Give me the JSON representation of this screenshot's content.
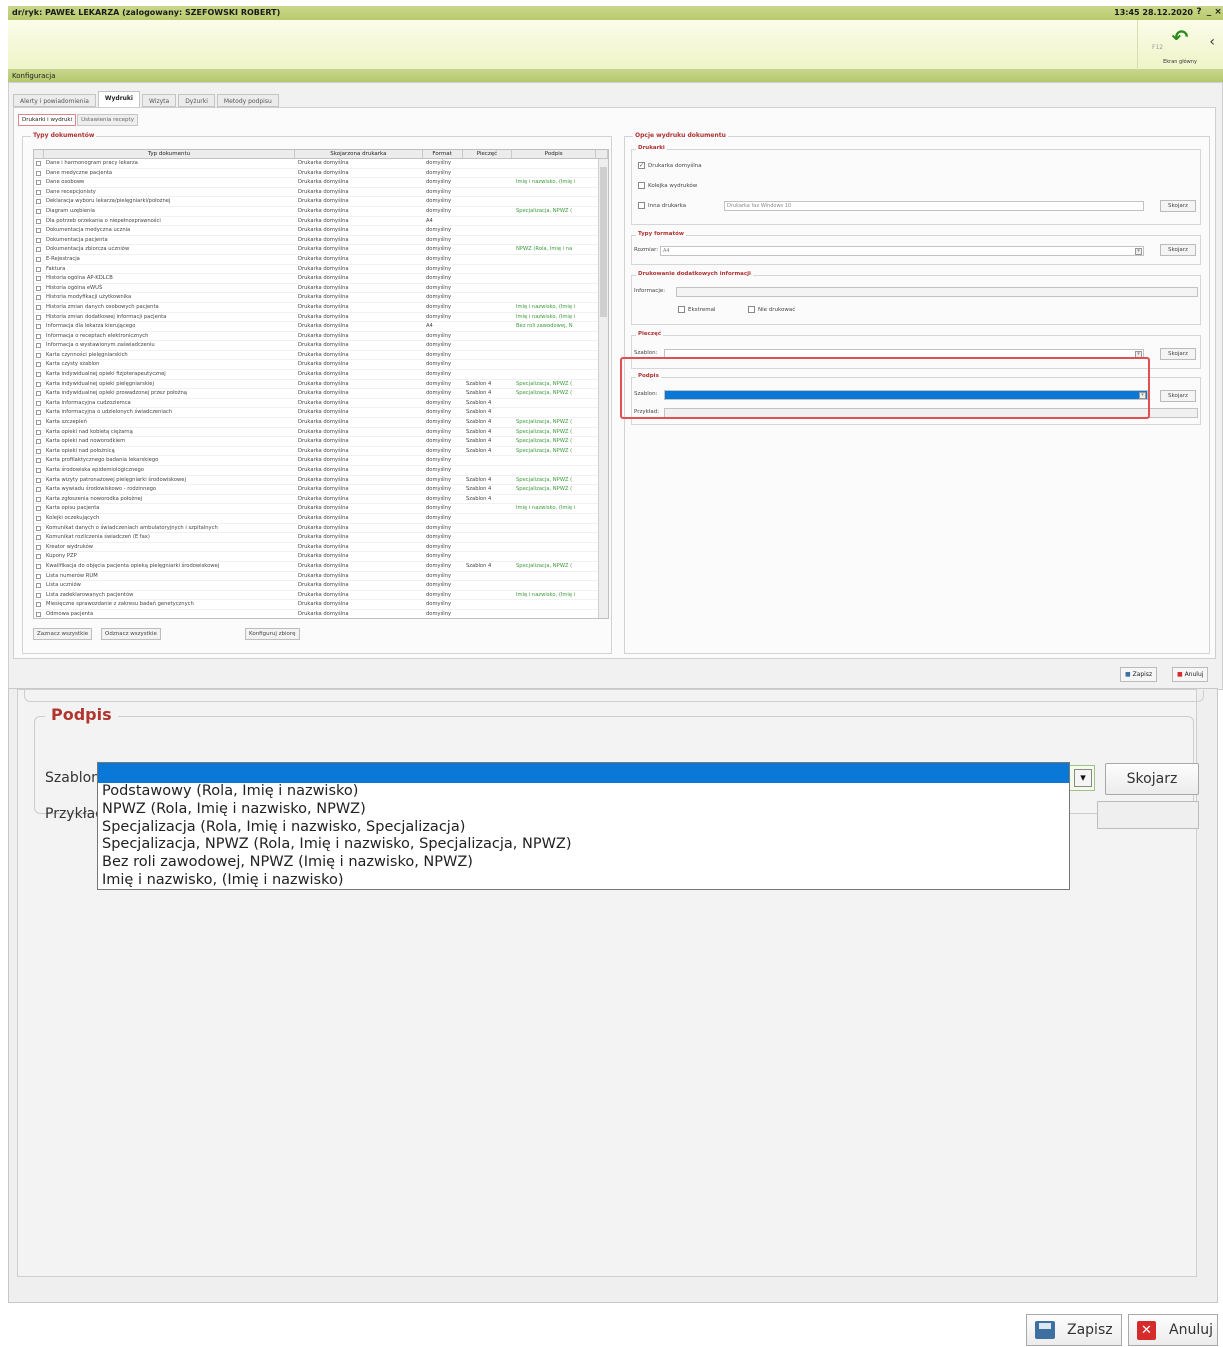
{
  "titlebar": {
    "title": "dr/ryk: PAWEŁ LEKARZA (zalogowany: SZEFOWSKI ROBERT)",
    "clock": "13:45 28.12.2020",
    "help": "?",
    "min": "_",
    "close": "×"
  },
  "toolbar": {
    "home_label": "Ekran główny",
    "home_icon": "undo-arrow-icon",
    "chevron": "‹",
    "small_text": "F12"
  },
  "section_title": "Konfiguracja",
  "tabs": [
    "Alerty i powiadomienia",
    "Wydruki",
    "Wizyta",
    "Dyżurki",
    "Metody podpisu"
  ],
  "subtabs": [
    "Drukarki i wydruki",
    "Ustawienia recepty"
  ],
  "doc_types": {
    "title": "Typy dokumentów",
    "headers": [
      "Typ dokumentu",
      "Skojarzona drukarka",
      "Format",
      "Pieczęć",
      "Podpis"
    ],
    "rows": [
      [
        "Dane i harmonogram pracy lekarza",
        "Drukarka domyślna",
        "domyślny",
        "",
        ""
      ],
      [
        "Dane medyczne pacjenta",
        "Drukarka domyślna",
        "domyślny",
        "",
        ""
      ],
      [
        "Dane osobowe",
        "Drukarka domyślna",
        "domyślny",
        "",
        "Imię i nazwisko, (Imię i"
      ],
      [
        "Dane recepcjonisty",
        "Drukarka domyślna",
        "domyślny",
        "",
        ""
      ],
      [
        "Deklaracja wyboru lekarza/pielęgniarki/położnej",
        "Drukarka domyślna",
        "domyślny",
        "",
        ""
      ],
      [
        "Diagram uzębienia",
        "Drukarka domyślna",
        "domyślny",
        "",
        "Specjalizacja, NPWZ ("
      ],
      [
        "Dla potrzeb orzekania o niepełnosprawności",
        "Drukarka domyślna",
        "A4",
        "",
        ""
      ],
      [
        "Dokumentacja medyczna ucznia",
        "Drukarka domyślna",
        "domyślny",
        "",
        ""
      ],
      [
        "Dokumentacja pacjenta",
        "Drukarka domyślna",
        "domyślny",
        "",
        ""
      ],
      [
        "Dokumentacja zbiorcza uczniów",
        "Drukarka domyślna",
        "domyślny",
        "",
        "NPWZ (Rola, Imię i na"
      ],
      [
        "E-Rejestracja",
        "Drukarka domyślna",
        "domyślny",
        "",
        ""
      ],
      [
        "Faktura",
        "Drukarka domyślna",
        "domyślny",
        "",
        ""
      ],
      [
        "Historia ogólna AP-KDLCB",
        "Drukarka domyślna",
        "domyślny",
        "",
        ""
      ],
      [
        "Historia ogólna eWUŚ",
        "Drukarka domyślna",
        "domyślny",
        "",
        ""
      ],
      [
        "Historia modyfikacji użytkownika",
        "Drukarka domyślna",
        "domyślny",
        "",
        ""
      ],
      [
        "Historia zmian danych osobowych pacjenta",
        "Drukarka domyślna",
        "domyślny",
        "",
        "Imię i nazwisko, (Imię i"
      ],
      [
        "Historia zmian dodatkowej informacji pacjenta",
        "Drukarka domyślna",
        "domyślny",
        "",
        "Imię i nazwisko, (Imię i"
      ],
      [
        "Informacja dla lekarza kierującego",
        "Drukarka domyślna",
        "A4",
        "",
        "Bez roli zawodowej, N"
      ],
      [
        "Informacja o receptach elektronicznych",
        "Drukarka domyślna",
        "domyślny",
        "",
        ""
      ],
      [
        "Informacja o wystawionym zaświadczeniu",
        "Drukarka domyślna",
        "domyślny",
        "",
        ""
      ],
      [
        "Karta czynności pielęgniarskich",
        "Drukarka domyślna",
        "domyślny",
        "",
        ""
      ],
      [
        "Karta czysty szablon",
        "Drukarka domyślna",
        "domyślny",
        "",
        ""
      ],
      [
        "Karta indywidualnej opieki fizjoterapeutycznej",
        "Drukarka domyślna",
        "domyślny",
        "",
        ""
      ],
      [
        "Karta indywidualnej opieki pielęgniarskiej",
        "Drukarka domyślna",
        "domyślny",
        "Szablon 4",
        "Specjalizacja, NPWZ ("
      ],
      [
        "Karta indywidualnej opieki prowadzonej przez położną",
        "Drukarka domyślna",
        "domyślny",
        "Szablon 4",
        "Specjalizacja, NPWZ ("
      ],
      [
        "Karta informacyjna cudzoziemca",
        "Drukarka domyślna",
        "domyślny",
        "Szablon 4",
        ""
      ],
      [
        "Karta informacyjna o udzielonych świadczeniach",
        "Drukarka domyślna",
        "domyślny",
        "Szablon 4",
        ""
      ],
      [
        "Karta szczepień",
        "Drukarka domyślna",
        "domyślny",
        "Szablon 4",
        "Specjalizacja, NPWZ ("
      ],
      [
        "Karta opieki nad kobietą ciężarną",
        "Drukarka domyślna",
        "domyślny",
        "Szablon 4",
        "Specjalizacja, NPWZ ("
      ],
      [
        "Karta opieki nad noworodkiem",
        "Drukarka domyślna",
        "domyślny",
        "Szablon 4",
        "Specjalizacja, NPWZ ("
      ],
      [
        "Karta opieki nad położnicą",
        "Drukarka domyślna",
        "domyślny",
        "Szablon 4",
        "Specjalizacja, NPWZ ("
      ],
      [
        "Karta profilaktycznego badania lekarskiego",
        "Drukarka domyślna",
        "domyślny",
        "",
        ""
      ],
      [
        "Karta środowiska epidemiologicznego",
        "Drukarka domyślna",
        "domyślny",
        "",
        ""
      ],
      [
        "Karta wizyty patronażowej pielęgniarki środowiskowej",
        "Drukarka domyślna",
        "domyślny",
        "Szablon 4",
        "Specjalizacja, NPWZ ("
      ],
      [
        "Karta wywiadu środowiskowo - rodzinnego",
        "Drukarka domyślna",
        "domyślny",
        "Szablon 4",
        "Specjalizacja, NPWZ ("
      ],
      [
        "Karta zgłoszenia noworodka położnej",
        "Drukarka domyślna",
        "domyślny",
        "Szablon 4",
        ""
      ],
      [
        "Karta opisu pacjenta",
        "Drukarka domyślna",
        "domyślny",
        "",
        "Imię i nazwisko, (Imię i"
      ],
      [
        "Kolejki oczekujących",
        "Drukarka domyślna",
        "domyślny",
        "",
        ""
      ],
      [
        "Komunikat danych o świadczeniach ambulatoryjnych i szpitalnych",
        "Drukarka domyślna",
        "domyślny",
        "",
        ""
      ],
      [
        "Komunikat rozliczenia świadczeń (E fax)",
        "Drukarka domyślna",
        "domyślny",
        "",
        ""
      ],
      [
        "Kreator wydruków",
        "Drukarka domyślna",
        "domyślny",
        "",
        ""
      ],
      [
        "Kupony PZP",
        "Drukarka domyślna",
        "domyślny",
        "",
        ""
      ],
      [
        "Kwalifikacja do objęcia pacjenta opieką pielęgniarki środowiskowej",
        "Drukarka domyślna",
        "domyślny",
        "Szablon 4",
        "Specjalizacja, NPWZ ("
      ],
      [
        "Lista numerów RUM",
        "Drukarka domyślna",
        "domyślny",
        "",
        ""
      ],
      [
        "Lista uczniów",
        "Drukarka domyślna",
        "domyślny",
        "",
        ""
      ],
      [
        "Lista zadeklarowanych pacjentów",
        "Drukarka domyślna",
        "domyślny",
        "",
        "Imię i nazwisko, (Imię i"
      ],
      [
        "Miesięczne sprawozdanie z zakresu badań genetycznych",
        "Drukarka domyślna",
        "domyślny",
        "",
        ""
      ],
      [
        "Odmowa pacjenta",
        "Drukarka domyślna",
        "domyślny",
        "",
        ""
      ]
    ],
    "select_all": "Zaznacz wszystkie",
    "deselect_all": "Odznacz wszystkie",
    "configure": "Konfiguruj zbiorę"
  },
  "print_opts": {
    "title": "Opcje wydruku dokumentu",
    "printers_title": "Drukarki",
    "default_printer": "Drukarka domyślna",
    "print_queue": "Kolejka wydruków",
    "other_printer": "Inna drukarka",
    "other_printer_value": "Drukarka fax Windows 10",
    "associate": "Skojarz",
    "formats_title": "Typy formatów",
    "format_label": "Rozmiar:",
    "format_value": "A4",
    "extra_title": "Drukowanie dodatkowych informacji",
    "extra_label": "Informacje:",
    "extra_cb1": "Ekstremal",
    "extra_cb2": "Nie drukować",
    "stamp_title": "Pieczęć",
    "stamp_label": "Szablon:",
    "sign_title": "Podpis",
    "sign_label": "Szablon:",
    "sign_example": "Przykład:"
  },
  "mini_footer": {
    "save": "Zapisz",
    "cancel": "Anuluj"
  },
  "zoom": {
    "title": "Podpis",
    "template_label": "Szablon:",
    "template_value": "",
    "associate": "Skojarz",
    "example_label": "Przykład:",
    "options": [
      "Podstawowy (Rola, Imię i nazwisko)",
      "NPWZ (Rola, Imię i nazwisko, NPWZ)",
      "Specjalizacja (Rola, Imię i nazwisko, Specjalizacja)",
      "Specjalizacja, NPWZ  (Rola, Imię i nazwisko, Specjalizacja, NPWZ)",
      "Bez roli zawodowej, NPWZ (Imię i nazwisko, NPWZ)",
      "Imię i nazwisko, (Imię i nazwisko)"
    ]
  },
  "footer": {
    "save": "Zapisz",
    "cancel": "Anuluj"
  },
  "colors": {
    "accent_red": "#b0352f",
    "selection_blue": "#0a78d7",
    "titlebar_green": "#c9d88a",
    "highlight_red": "#e05050"
  }
}
